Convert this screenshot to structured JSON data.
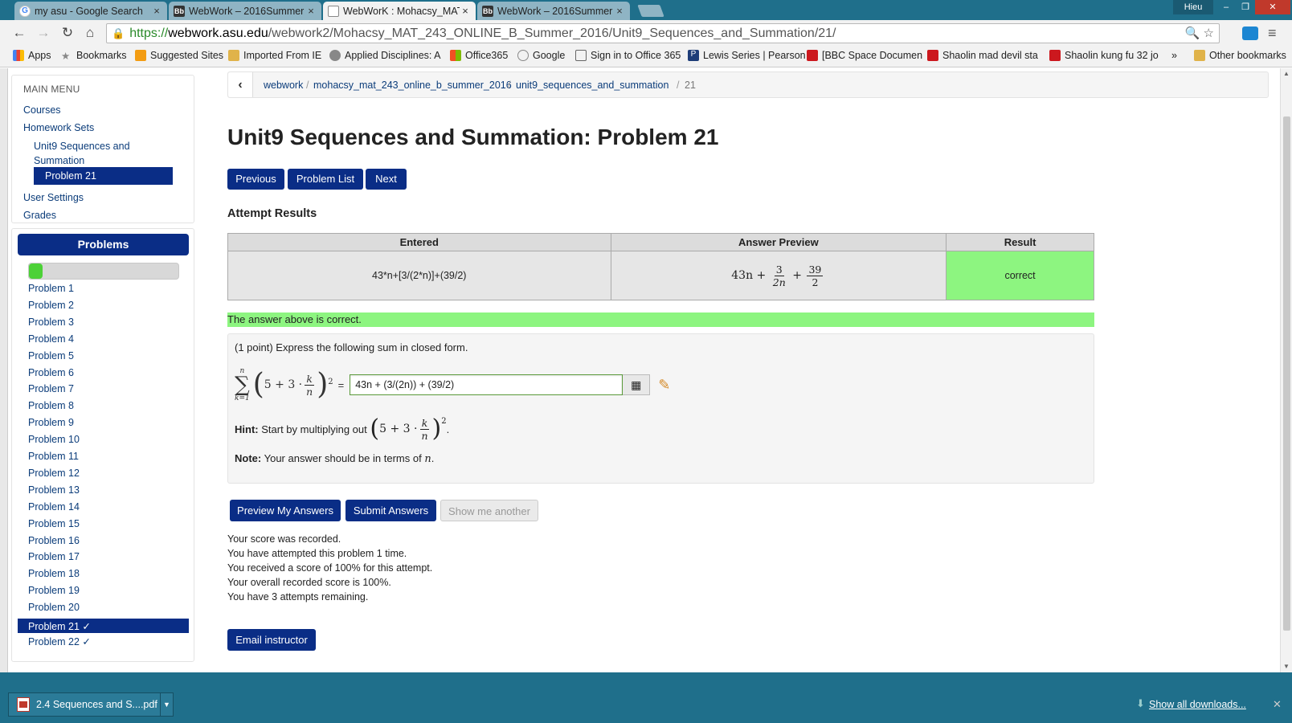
{
  "browser": {
    "tabs": [
      {
        "title": "my asu - Google Search",
        "icon": "google-icon"
      },
      {
        "title": "WebWork – 2016Summer",
        "icon": "blackboard-icon"
      },
      {
        "title": "WebWorK : Mohacsy_MAT",
        "icon": "document-icon"
      },
      {
        "title": "WebWork – 2016Summer",
        "icon": "blackboard-icon"
      }
    ],
    "window_user": "Hieu",
    "url_scheme": "https://",
    "url_host": "webwork.asu.edu",
    "url_path": "/webwork2/Mohacsy_MAT_243_ONLINE_B_Summer_2016/Unit9_Sequences_and_Summation/21/",
    "bookmarks": [
      "Apps",
      "Bookmarks",
      "Suggested Sites",
      "Imported From IE",
      "Applied Disciplines: A",
      "Office365",
      "Google",
      "Sign in to Office 365",
      "Lewis Series | Pearson",
      "[BBC Space Documen",
      "Shaolin mad devil sta",
      "Shaolin kung fu 32 jo"
    ],
    "bookmarks_overflow": "»",
    "other_bookmarks": "Other bookmarks"
  },
  "sidebar": {
    "main_menu_title": "MAIN MENU",
    "courses": "Courses",
    "homework_sets": "Homework Sets",
    "set_name_line1": "Unit9 Sequences and",
    "set_name_line2": "Summation",
    "current_problem": "Problem 21",
    "user_settings": "User Settings",
    "grades": "Grades",
    "problems_header": "Problems",
    "progress_fraction": 0.09,
    "problems": [
      "Problem 1",
      "Problem 2",
      "Problem 3",
      "Problem 4",
      "Problem 5",
      "Problem 6",
      "Problem 7",
      "Problem 8",
      "Problem 9",
      "Problem 10",
      "Problem 11",
      "Problem 12",
      "Problem 13",
      "Problem 14",
      "Problem 15",
      "Problem 16",
      "Problem 17",
      "Problem 18",
      "Problem 19",
      "Problem 20",
      "Problem 21 ✓",
      "Problem 22 ✓"
    ]
  },
  "breadcrumb": {
    "items": [
      "webwork",
      "mohacsy_mat_243_online_b_summer_2016",
      "unit9_sequences_and_summation"
    ],
    "current": "21"
  },
  "main": {
    "title": "Unit9 Sequences and Summation: Problem 21",
    "prev_label": "Previous",
    "list_label": "Problem List",
    "next_label": "Next",
    "attempt_heading": "Attempt Results",
    "table_headers": [
      "Entered",
      "Answer Preview",
      "Result"
    ],
    "entered": "43*n+[3/(2*n)]+(39/2)",
    "preview_term": "43n +",
    "preview_frac1_num": "3",
    "preview_frac1_den": "2n",
    "preview_frac2_num": "39",
    "preview_frac2_den": "2",
    "result": "correct",
    "correct_banner": "The answer above is correct.",
    "problem_statement": "(1 point) Express the following sum in closed form.",
    "answer_value": "43n + (3/(2n)) + (39/2)",
    "hint_label": "Hint:",
    "hint_text": "Start by multiplying out",
    "note_label": "Note:",
    "note_text": "Your answer should be in terms of",
    "note_var": "n",
    "preview_btn": "Preview My Answers",
    "submit_btn": "Submit Answers",
    "another_btn": "Show me another",
    "score_lines": [
      "Your score was recorded.",
      "You have attempted this problem 1 time.",
      "You received a score of 100% for this attempt.",
      "Your overall recorded score is 100%.",
      "You have 3 attempts remaining."
    ],
    "email_btn": "Email instructor"
  },
  "downloads": {
    "file": "2.4 Sequences and S....pdf",
    "show_all": "Show all downloads..."
  },
  "colors": {
    "accent": "#0a2d86",
    "correct": "#8df580",
    "chrome": "#1f6f8b"
  }
}
